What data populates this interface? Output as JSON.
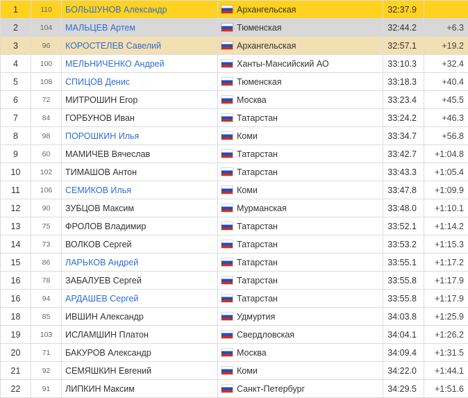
{
  "results": [
    {
      "place": "1",
      "bib": "110",
      "name": "БОЛЬШУНОВ Александр",
      "linked": true,
      "flag_icon": "russia-flag-icon",
      "region": "Архангельская",
      "time": "32:37.9",
      "gap": ""
    },
    {
      "place": "2",
      "bib": "104",
      "name": "МАЛЬЦЕВ Артем",
      "linked": true,
      "flag_icon": "russia-flag-icon",
      "region": "Тюменская",
      "time": "32:44.2",
      "gap": "+6.3"
    },
    {
      "place": "3",
      "bib": "96",
      "name": "КОРОСТЕЛЕВ Савелий",
      "linked": true,
      "flag_icon": "russia-flag-icon",
      "region": "Архангельская",
      "time": "32:57.1",
      "gap": "+19.2"
    },
    {
      "place": "4",
      "bib": "100",
      "name": "МЕЛЬНИЧЕНКО Андрей",
      "linked": true,
      "flag_icon": "russia-flag-icon",
      "region": "Ханты-Мансийский АО",
      "time": "33:10.3",
      "gap": "+32.4"
    },
    {
      "place": "5",
      "bib": "108",
      "name": "СПИЦОВ Денис",
      "linked": true,
      "flag_icon": "russia-flag-icon",
      "region": "Тюменская",
      "time": "33:18.3",
      "gap": "+40.4"
    },
    {
      "place": "6",
      "bib": "72",
      "name": "МИТРОШИН Егор",
      "linked": false,
      "flag_icon": "russia-flag-icon",
      "region": "Москва",
      "time": "33:23.4",
      "gap": "+45.5"
    },
    {
      "place": "7",
      "bib": "84",
      "name": "ГОРБУНОВ Иван",
      "linked": false,
      "flag_icon": "russia-flag-icon",
      "region": "Татарстан",
      "time": "33:24.2",
      "gap": "+46.3"
    },
    {
      "place": "8",
      "bib": "98",
      "name": "ПОРОШКИН Илья",
      "linked": true,
      "flag_icon": "russia-flag-icon",
      "region": "Коми",
      "time": "33:34.7",
      "gap": "+56.8"
    },
    {
      "place": "9",
      "bib": "60",
      "name": "МАМИЧЕВ Вячеслав",
      "linked": false,
      "flag_icon": "russia-flag-icon",
      "region": "Татарстан",
      "time": "33:42.7",
      "gap": "+1:04.8"
    },
    {
      "place": "10",
      "bib": "102",
      "name": "ТИМАШОВ Антон",
      "linked": false,
      "flag_icon": "russia-flag-icon",
      "region": "Татарстан",
      "time": "33:43.3",
      "gap": "+1:05.4"
    },
    {
      "place": "11",
      "bib": "106",
      "name": "СЕМИКОВ Илья",
      "linked": true,
      "flag_icon": "russia-flag-icon",
      "region": "Коми",
      "time": "33:47.8",
      "gap": "+1:09.9"
    },
    {
      "place": "12",
      "bib": "90",
      "name": "ЗУБЦОВ Максим",
      "linked": false,
      "flag_icon": "russia-flag-icon",
      "region": "Мурманская",
      "time": "33:48.0",
      "gap": "+1:10.1"
    },
    {
      "place": "13",
      "bib": "75",
      "name": "ФРОЛОВ Владимир",
      "linked": false,
      "flag_icon": "russia-flag-icon",
      "region": "Татарстан",
      "time": "33:52.1",
      "gap": "+1:14.2"
    },
    {
      "place": "14",
      "bib": "73",
      "name": "ВОЛКОВ Сергей",
      "linked": false,
      "flag_icon": "russia-flag-icon",
      "region": "Татарстан",
      "time": "33:53.2",
      "gap": "+1:15.3"
    },
    {
      "place": "15",
      "bib": "86",
      "name": "ЛАРЬКОВ Андрей",
      "linked": true,
      "flag_icon": "russia-flag-icon",
      "region": "Татарстан",
      "time": "33:55.1",
      "gap": "+1:17.2"
    },
    {
      "place": "16",
      "bib": "78",
      "name": "ЗАБАЛУЕВ Сергей",
      "linked": false,
      "flag_icon": "russia-flag-icon",
      "region": "Татарстан",
      "time": "33:55.8",
      "gap": "+1:17.9"
    },
    {
      "place": "16",
      "bib": "94",
      "name": "АРДАШЕВ Сергей",
      "linked": true,
      "flag_icon": "russia-flag-icon",
      "region": "Татарстан",
      "time": "33:55.8",
      "gap": "+1:17.9"
    },
    {
      "place": "18",
      "bib": "85",
      "name": "ИВШИН Александр",
      "linked": false,
      "flag_icon": "russia-flag-icon",
      "region": "Удмуртия",
      "time": "34:03.8",
      "gap": "+1:25.9"
    },
    {
      "place": "19",
      "bib": "103",
      "name": "ИСЛАМШИН Платон",
      "linked": false,
      "flag_icon": "russia-flag-icon",
      "region": "Свердловская",
      "time": "34:04.1",
      "gap": "+1:26.2"
    },
    {
      "place": "20",
      "bib": "71",
      "name": "БАКУРОВ Александр",
      "linked": false,
      "flag_icon": "russia-flag-icon",
      "region": "Москва",
      "time": "34:09.4",
      "gap": "+1:31.5"
    },
    {
      "place": "21",
      "bib": "92",
      "name": "СЕМЯШКИН Евгений",
      "linked": false,
      "flag_icon": "russia-flag-icon",
      "region": "Коми",
      "time": "34:22.0",
      "gap": "+1:44.1"
    },
    {
      "place": "22",
      "bib": "91",
      "name": "ЛИПКИН Максим",
      "linked": false,
      "flag_icon": "russia-flag-icon",
      "region": "Санкт-Петербург",
      "time": "34:29.5",
      "gap": "+1:51.6"
    }
  ],
  "colors": {
    "gold_row": "#ffd21f",
    "silver_row": "#d8d8d8",
    "bronze_row": "#f3dfb4",
    "link": "#2f6fd0"
  }
}
